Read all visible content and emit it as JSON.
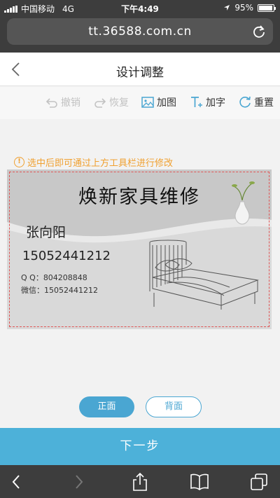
{
  "status": {
    "carrier": "中国移动",
    "network": "4G",
    "time": "下午4:49",
    "battery": "95%"
  },
  "browser": {
    "url": "tt.36588.com.cn"
  },
  "header": {
    "title": "设计调整"
  },
  "toolbar": {
    "undo": "撤销",
    "redo": "恢复",
    "add_image": "加图",
    "add_text": "加字",
    "reset": "重置"
  },
  "hint": "选中后即可通过上方工具栏进行修改",
  "card": {
    "title": "焕新家具维修",
    "name": "张向阳",
    "phone": "15052441212",
    "qq": "Q Q：804208848",
    "wechat": "微信：15052441212"
  },
  "side_toggle": {
    "front": "正面",
    "back": "背面",
    "selected": "front"
  },
  "next_label": "下一步",
  "colors": {
    "accent": "#4db1d9",
    "hint": "#f0a030",
    "selection_border": "#e05555"
  }
}
